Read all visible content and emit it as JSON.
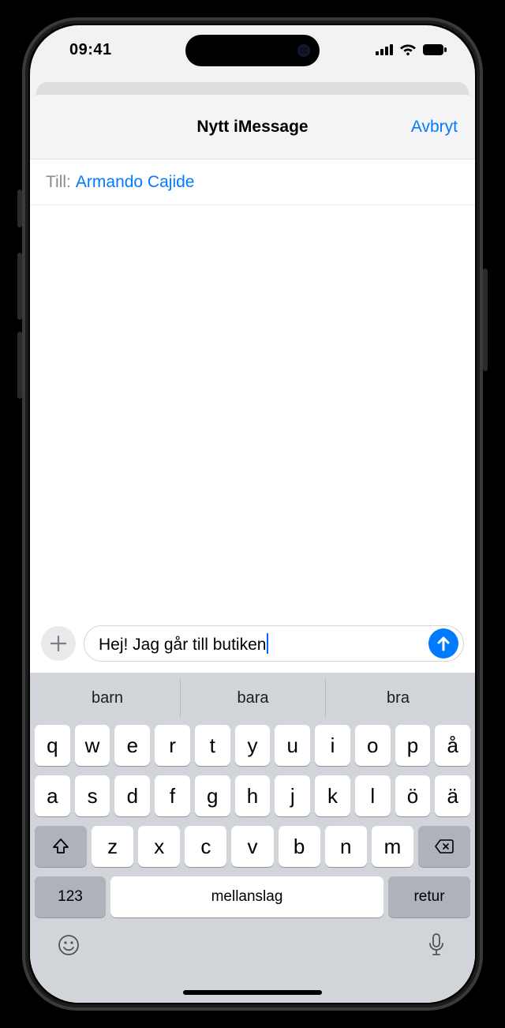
{
  "status": {
    "time": "09:41"
  },
  "nav": {
    "title": "Nytt iMessage",
    "cancel": "Avbryt"
  },
  "to": {
    "label": "Till:",
    "value": "Armando Cajide"
  },
  "message": {
    "text": "Hej! Jag går till butiken"
  },
  "suggestions": [
    "barn",
    "bara",
    "bra"
  ],
  "keyboard": {
    "row1": [
      "q",
      "w",
      "e",
      "r",
      "t",
      "y",
      "u",
      "i",
      "o",
      "p",
      "å"
    ],
    "row2": [
      "a",
      "s",
      "d",
      "f",
      "g",
      "h",
      "j",
      "k",
      "l",
      "ö",
      "ä"
    ],
    "row3": [
      "z",
      "x",
      "c",
      "v",
      "b",
      "n",
      "m"
    ],
    "numbers": "123",
    "space": "mellanslag",
    "return": "retur"
  }
}
